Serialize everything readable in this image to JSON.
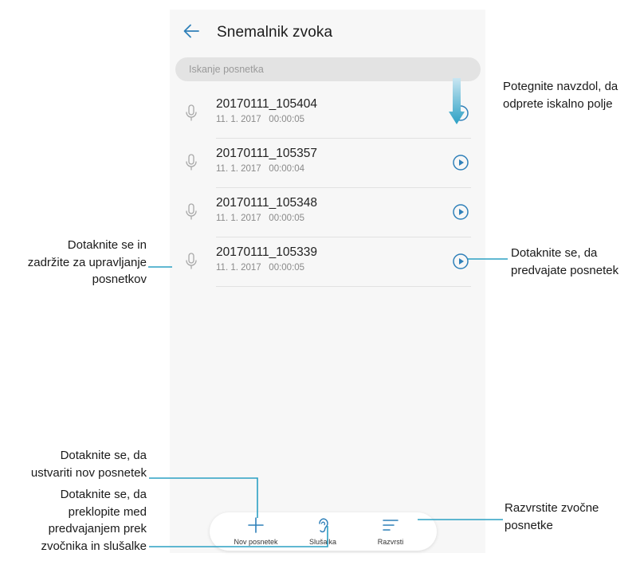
{
  "app": {
    "title": "Snemalnik zvoka",
    "search_placeholder": "Iskanje posnetka"
  },
  "recordings": [
    {
      "name": "20170111_105404",
      "date": "11. 1. 2017",
      "duration": "00:00:05"
    },
    {
      "name": "20170111_105357",
      "date": "11. 1. 2017",
      "duration": "00:00:04"
    },
    {
      "name": "20170111_105348",
      "date": "11. 1. 2017",
      "duration": "00:00:05"
    },
    {
      "name": "20170111_105339",
      "date": "11. 1. 2017",
      "duration": "00:00:05"
    }
  ],
  "toolbar": {
    "new_label": "Nov posnetek",
    "earpiece_label": "Slušalka",
    "sort_label": "Razvrsti"
  },
  "annotations": {
    "pull_down": [
      "Potegnite navzdol, da",
      "odprete iskalno polje"
    ],
    "hold_manage": [
      "Dotaknite se in",
      "zadržite za upravljanje",
      "posnetkov"
    ],
    "tap_play": [
      "Dotaknite se, da",
      "predvajate posnetek"
    ],
    "new_recording": [
      "Dotaknite se, da",
      "ustvariti nov posnetek"
    ],
    "switch_output": [
      "Dotaknite se, da",
      "preklopite med",
      "predvajanjem prek",
      "zvočnika in slušalke"
    ],
    "sort": [
      "Razvrstite zvočne",
      "posnetke"
    ]
  },
  "colors": {
    "accent": "#2f80b9",
    "pull_arrow_top": "#c9e6f2",
    "pull_arrow_bottom": "#2ba0c4",
    "line": "#2ba0c4"
  },
  "icons": {
    "back": "arrow-left-icon",
    "recording": "microphone-icon",
    "play": "play-circle-icon",
    "new": "plus-icon",
    "earpiece": "ear-icon",
    "sort": "sort-lines-icon"
  }
}
